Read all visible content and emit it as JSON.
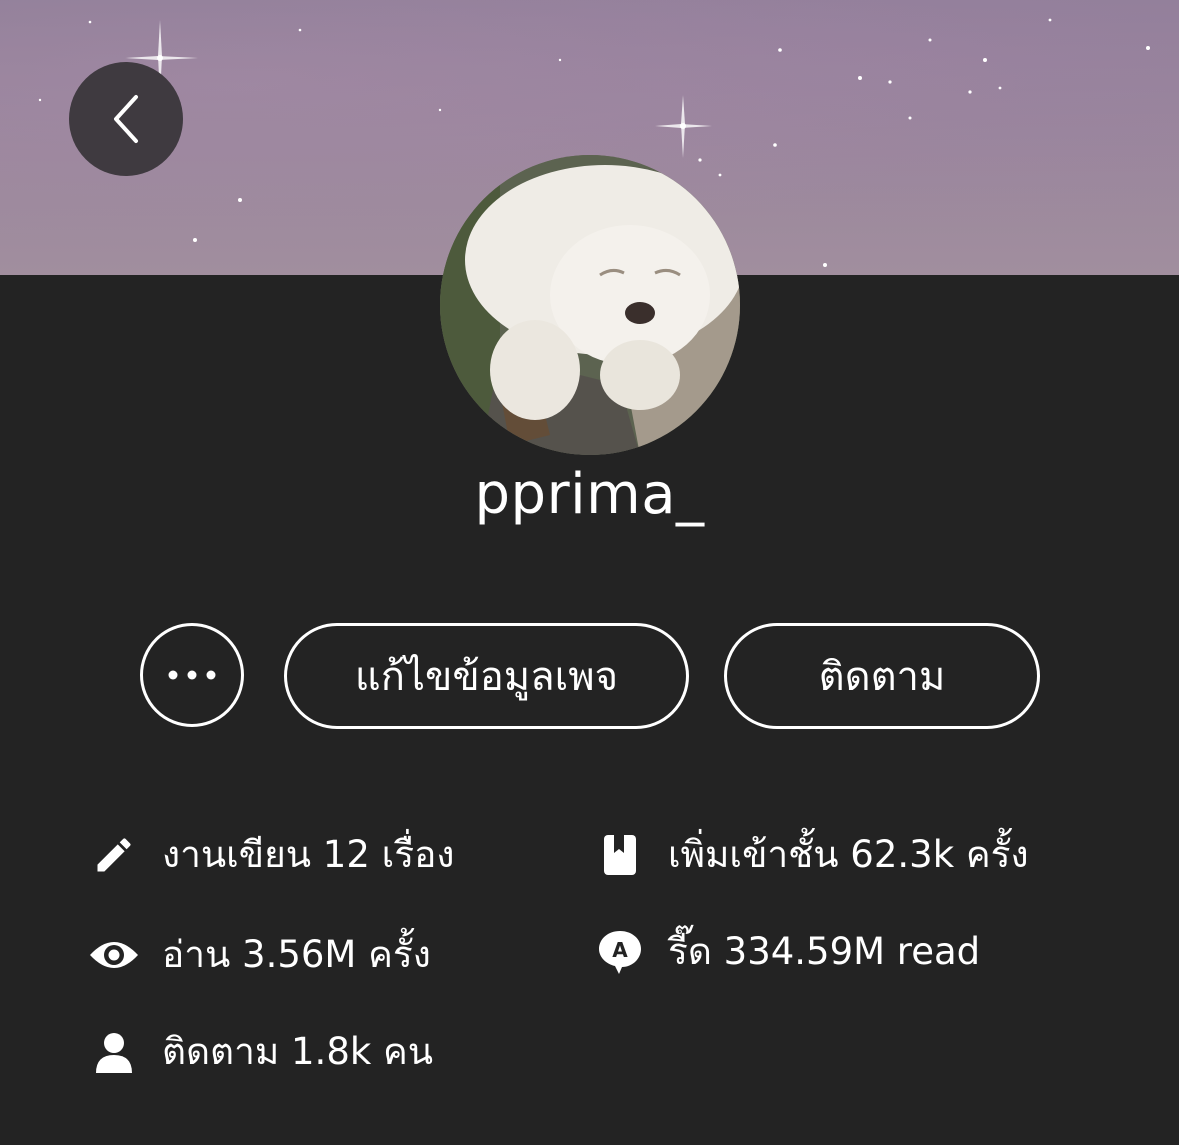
{
  "profile": {
    "username": "pprima_"
  },
  "actions": {
    "more_label": "•••",
    "edit_label": "แก้ไขข้อมูลเพจ",
    "follow_label": "ติดตาม"
  },
  "stats": {
    "works": "งานเขียน 12 เรื่อง",
    "reads": "อ่าน 3.56M ครั้ง",
    "followers": "ติดตาม 1.8k คน",
    "shelf": "เพิ่มเข้าชั้น 62.3k ครั้ง",
    "read_count": "รี๊ด 334.59M read"
  },
  "icons": {
    "back": "chevron-left-icon",
    "works": "pencil-icon",
    "reads": "eye-icon",
    "followers": "person-icon",
    "shelf": "bookmark-book-icon",
    "read_count": "speech-bubble-a-icon"
  },
  "colors": {
    "background": "#232323",
    "text": "#ffffff",
    "cover": "#9a879c",
    "back_button": "#3f3a40"
  }
}
